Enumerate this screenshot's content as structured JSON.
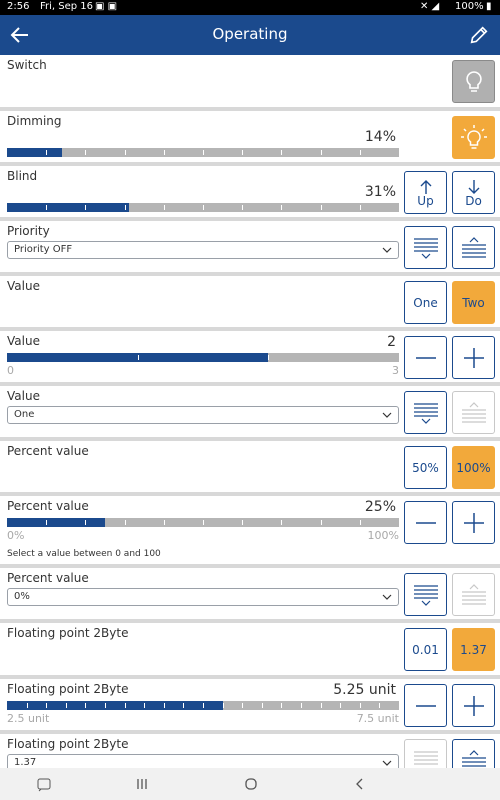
{
  "status": {
    "time": "2:56",
    "date": "Fri, Sep 16",
    "battery": "100%"
  },
  "header": {
    "title": "Operating"
  },
  "rows": {
    "switch": {
      "label": "Switch"
    },
    "dimming": {
      "label": "Dimming",
      "value_text": "14%",
      "fraction": 0.14
    },
    "blind": {
      "label": "Blind",
      "value_text": "31%",
      "fraction": 0.31,
      "up_label": "Up",
      "down_label": "Do"
    },
    "priority": {
      "label": "Priority",
      "selected": "Priority OFF"
    },
    "value_buttons": {
      "label": "Value",
      "option1": "One",
      "option2": "Two"
    },
    "value_slider": {
      "label": "Value",
      "value_text": "2",
      "min": "0",
      "max": "3",
      "fraction": 0.6667
    },
    "value_select": {
      "label": "Value",
      "selected": "One"
    },
    "percent_buttons": {
      "label": "Percent value",
      "option1": "50%",
      "option2": "100%"
    },
    "percent_slider": {
      "label": "Percent value",
      "value_text": "25%",
      "min": "0%",
      "max": "100%",
      "hint": "Select a value between 0 and 100",
      "fraction": 0.25
    },
    "percent_select": {
      "label": "Percent value",
      "selected": "0%"
    },
    "float_buttons": {
      "label": "Floating point 2Byte",
      "option1": "0.01",
      "option2": "1.37"
    },
    "float_slider": {
      "label": "Floating point 2Byte",
      "value_text": "5.25 unit",
      "min": "2.5 unit",
      "max": "7.5 unit",
      "fraction": 0.55
    },
    "float_select": {
      "label": "Floating point 2Byte",
      "selected": "1.37"
    }
  },
  "colors": {
    "primary": "#1b4a8d",
    "accent": "#f2a93b",
    "track": "#b5b5b5"
  }
}
